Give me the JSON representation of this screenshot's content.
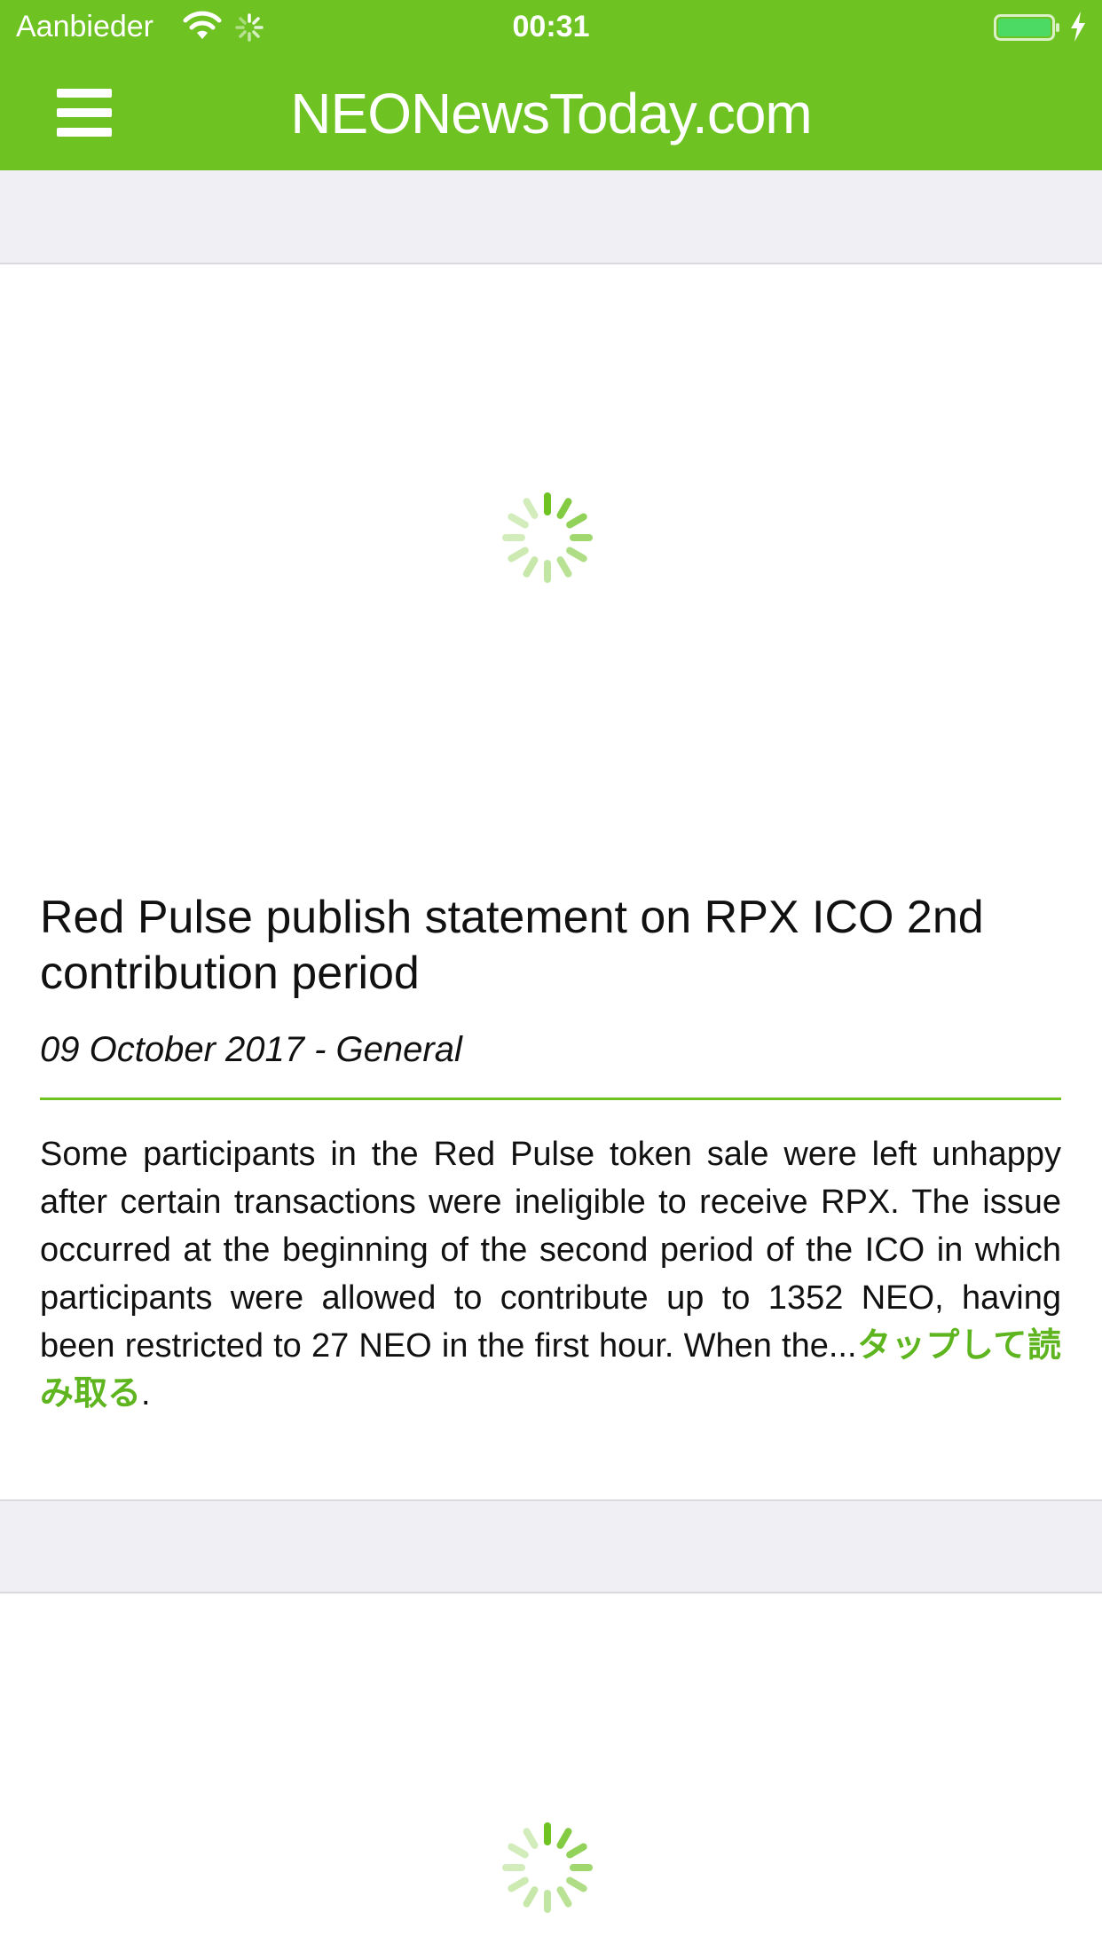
{
  "status_bar": {
    "carrier": "Aanbieder",
    "time": "00:31",
    "battery_color": "#4cd964"
  },
  "nav": {
    "title": "NEONewsToday.com",
    "menu_icon": "hamburger-menu-icon"
  },
  "colors": {
    "brand": "#6ec323",
    "link": "#5fb51f",
    "separator_band": "#efeff4",
    "text": "#111111"
  },
  "articles": [
    {
      "image_state": "loading",
      "title": "Red Pulse publish statement on RPX ICO 2nd contribution period",
      "meta": "09 October 2017 - General",
      "excerpt": "Some participants in the Red Pulse token sale were left unhappy after certain transactions were ineligible to receive RPX. The issue occurred at the beginning of the second period of the ICO in which participants were allowed to contribute up to 1352 NEO, having been restricted to 27 NEO in the first hour. When the...",
      "read_more": "タップして読み取る",
      "trailing": "."
    },
    {
      "image_state": "loading"
    }
  ]
}
